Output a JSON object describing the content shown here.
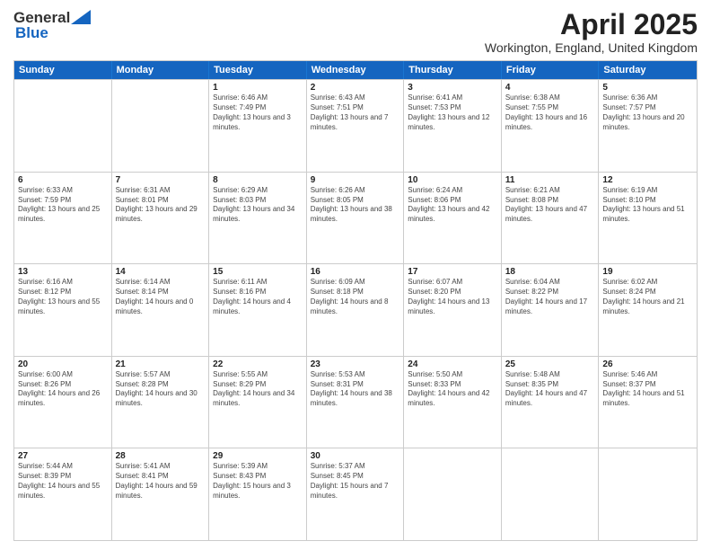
{
  "header": {
    "logo_general": "General",
    "logo_blue": "Blue",
    "month_title": "April 2025",
    "location": "Workington, England, United Kingdom"
  },
  "days_of_week": [
    "Sunday",
    "Monday",
    "Tuesday",
    "Wednesday",
    "Thursday",
    "Friday",
    "Saturday"
  ],
  "weeks": [
    [
      {
        "day": "",
        "info": ""
      },
      {
        "day": "",
        "info": ""
      },
      {
        "day": "1",
        "info": "Sunrise: 6:46 AM\nSunset: 7:49 PM\nDaylight: 13 hours and 3 minutes."
      },
      {
        "day": "2",
        "info": "Sunrise: 6:43 AM\nSunset: 7:51 PM\nDaylight: 13 hours and 7 minutes."
      },
      {
        "day": "3",
        "info": "Sunrise: 6:41 AM\nSunset: 7:53 PM\nDaylight: 13 hours and 12 minutes."
      },
      {
        "day": "4",
        "info": "Sunrise: 6:38 AM\nSunset: 7:55 PM\nDaylight: 13 hours and 16 minutes."
      },
      {
        "day": "5",
        "info": "Sunrise: 6:36 AM\nSunset: 7:57 PM\nDaylight: 13 hours and 20 minutes."
      }
    ],
    [
      {
        "day": "6",
        "info": "Sunrise: 6:33 AM\nSunset: 7:59 PM\nDaylight: 13 hours and 25 minutes."
      },
      {
        "day": "7",
        "info": "Sunrise: 6:31 AM\nSunset: 8:01 PM\nDaylight: 13 hours and 29 minutes."
      },
      {
        "day": "8",
        "info": "Sunrise: 6:29 AM\nSunset: 8:03 PM\nDaylight: 13 hours and 34 minutes."
      },
      {
        "day": "9",
        "info": "Sunrise: 6:26 AM\nSunset: 8:05 PM\nDaylight: 13 hours and 38 minutes."
      },
      {
        "day": "10",
        "info": "Sunrise: 6:24 AM\nSunset: 8:06 PM\nDaylight: 13 hours and 42 minutes."
      },
      {
        "day": "11",
        "info": "Sunrise: 6:21 AM\nSunset: 8:08 PM\nDaylight: 13 hours and 47 minutes."
      },
      {
        "day": "12",
        "info": "Sunrise: 6:19 AM\nSunset: 8:10 PM\nDaylight: 13 hours and 51 minutes."
      }
    ],
    [
      {
        "day": "13",
        "info": "Sunrise: 6:16 AM\nSunset: 8:12 PM\nDaylight: 13 hours and 55 minutes."
      },
      {
        "day": "14",
        "info": "Sunrise: 6:14 AM\nSunset: 8:14 PM\nDaylight: 14 hours and 0 minutes."
      },
      {
        "day": "15",
        "info": "Sunrise: 6:11 AM\nSunset: 8:16 PM\nDaylight: 14 hours and 4 minutes."
      },
      {
        "day": "16",
        "info": "Sunrise: 6:09 AM\nSunset: 8:18 PM\nDaylight: 14 hours and 8 minutes."
      },
      {
        "day": "17",
        "info": "Sunrise: 6:07 AM\nSunset: 8:20 PM\nDaylight: 14 hours and 13 minutes."
      },
      {
        "day": "18",
        "info": "Sunrise: 6:04 AM\nSunset: 8:22 PM\nDaylight: 14 hours and 17 minutes."
      },
      {
        "day": "19",
        "info": "Sunrise: 6:02 AM\nSunset: 8:24 PM\nDaylight: 14 hours and 21 minutes."
      }
    ],
    [
      {
        "day": "20",
        "info": "Sunrise: 6:00 AM\nSunset: 8:26 PM\nDaylight: 14 hours and 26 minutes."
      },
      {
        "day": "21",
        "info": "Sunrise: 5:57 AM\nSunset: 8:28 PM\nDaylight: 14 hours and 30 minutes."
      },
      {
        "day": "22",
        "info": "Sunrise: 5:55 AM\nSunset: 8:29 PM\nDaylight: 14 hours and 34 minutes."
      },
      {
        "day": "23",
        "info": "Sunrise: 5:53 AM\nSunset: 8:31 PM\nDaylight: 14 hours and 38 minutes."
      },
      {
        "day": "24",
        "info": "Sunrise: 5:50 AM\nSunset: 8:33 PM\nDaylight: 14 hours and 42 minutes."
      },
      {
        "day": "25",
        "info": "Sunrise: 5:48 AM\nSunset: 8:35 PM\nDaylight: 14 hours and 47 minutes."
      },
      {
        "day": "26",
        "info": "Sunrise: 5:46 AM\nSunset: 8:37 PM\nDaylight: 14 hours and 51 minutes."
      }
    ],
    [
      {
        "day": "27",
        "info": "Sunrise: 5:44 AM\nSunset: 8:39 PM\nDaylight: 14 hours and 55 minutes."
      },
      {
        "day": "28",
        "info": "Sunrise: 5:41 AM\nSunset: 8:41 PM\nDaylight: 14 hours and 59 minutes."
      },
      {
        "day": "29",
        "info": "Sunrise: 5:39 AM\nSunset: 8:43 PM\nDaylight: 15 hours and 3 minutes."
      },
      {
        "day": "30",
        "info": "Sunrise: 5:37 AM\nSunset: 8:45 PM\nDaylight: 15 hours and 7 minutes."
      },
      {
        "day": "",
        "info": ""
      },
      {
        "day": "",
        "info": ""
      },
      {
        "day": "",
        "info": ""
      }
    ]
  ]
}
